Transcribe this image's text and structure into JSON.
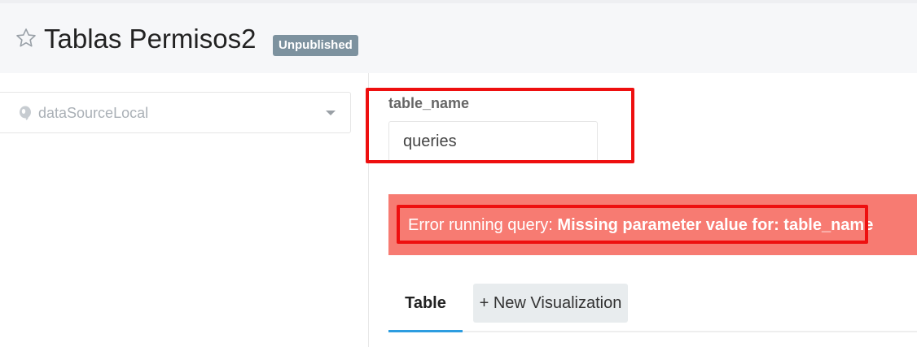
{
  "header": {
    "title": "Tablas Permisos2",
    "badge": "Unpublished",
    "favorite_icon": "star-outline-icon"
  },
  "datasource": {
    "icon": "postgresql-icon",
    "label": "dataSourceLocal"
  },
  "parameter": {
    "name": "table_name",
    "value": "queries"
  },
  "error": {
    "prefix": "Error running query: ",
    "message": "Missing parameter value for: table_name",
    "color": "#f77b72"
  },
  "tabs": [
    {
      "label": "Table",
      "active": true
    },
    {
      "label": "+ New Visualization",
      "active": false
    }
  ],
  "colors": {
    "highlight": "#ee0f0f",
    "badge": "#7d929f",
    "active_tab_underline": "#2d9de0"
  }
}
